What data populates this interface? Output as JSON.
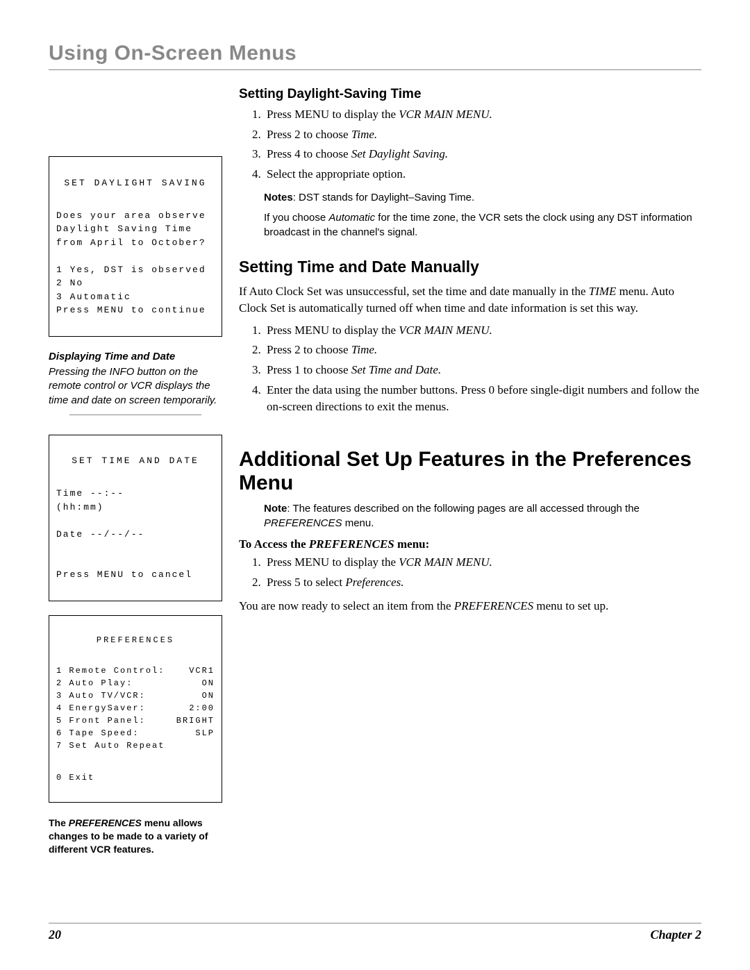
{
  "chapterTitle": "Using On-Screen Menus",
  "sidebar": {
    "osd_dst": {
      "title": "SET DAYLIGHT SAVING",
      "body": "Does your area observe\nDaylight Saving Time\nfrom April to October?\n\n1 Yes, DST is observed\n2 No\n3 Automatic\nPress MENU to continue"
    },
    "displayHeading": "Displaying Time and Date",
    "displayText": "Pressing the INFO button on the remote control or VCR displays the time and date on screen temporarily.",
    "osd_time": {
      "title": "SET TIME AND DATE",
      "body": "Time --:--\n    (hh:mm)\n\nDate --/--/--\n\n\nPress MENU to cancel"
    },
    "osd_pref": {
      "title": "PREFERENCES",
      "rows": [
        {
          "n": "1",
          "label": "Remote Control:",
          "val": "VCR1"
        },
        {
          "n": "2",
          "label": "Auto Play:",
          "val": "ON"
        },
        {
          "n": "3",
          "label": "Auto TV/VCR:",
          "val": "ON"
        },
        {
          "n": "4",
          "label": "EnergySaver:",
          "val": "2:00"
        },
        {
          "n": "5",
          "label": "Front Panel:",
          "val": "BRIGHT"
        },
        {
          "n": "6",
          "label": "Tape Speed:",
          "val": "SLP"
        },
        {
          "n": "7",
          "label": "Set Auto Repeat",
          "val": ""
        }
      ],
      "exit": "0 Exit"
    },
    "prefCaption": "The PREFERENCES menu allows changes to be made to a variety of different VCR features."
  },
  "main": {
    "dst": {
      "heading": "Setting Daylight-Saving Time",
      "steps": [
        {
          "pre": "Press MENU to display the ",
          "ital": "VCR MAIN MENU.",
          "post": ""
        },
        {
          "pre": "Press 2 to choose ",
          "ital": "Time.",
          "post": ""
        },
        {
          "pre": "Press 4 to choose ",
          "ital": "Set Daylight Saving.",
          "post": ""
        },
        {
          "pre": "Select the appropriate option.",
          "ital": "",
          "post": ""
        }
      ],
      "noteLabel": "Notes",
      "note1": ": DST stands for Daylight–Saving Time.",
      "note2a": "If you choose ",
      "note2ital": "Automatic",
      "note2b": " for the time zone, the VCR sets the clock using any DST information broadcast in the channel's signal."
    },
    "timedate": {
      "heading": "Setting Time and Date Manually",
      "intro_a": "If Auto Clock Set was unsuccessful, set the time and date manually in the ",
      "intro_ital": "TIME",
      "intro_b": " menu. Auto Clock Set is automatically turned off when time and date information is set this way.",
      "steps": [
        {
          "pre": "Press MENU to display the ",
          "ital": "VCR MAIN MENU.",
          "post": ""
        },
        {
          "pre": "Press 2 to choose ",
          "ital": "Time.",
          "post": ""
        },
        {
          "pre": "Press 1 to choose ",
          "ital": "Set Time and Date.",
          "post": ""
        },
        {
          "pre": "Enter the data using the number buttons. Press 0 before single-digit numbers and follow the on-screen directions to exit the menus.",
          "ital": "",
          "post": ""
        }
      ]
    },
    "prefSection": {
      "heading": "Additional Set Up Features in the Preferences Menu",
      "noteLabel": "Note",
      "note_a": ": The features described on the following pages are all accessed through the ",
      "note_ital": "PREFERENCES",
      "note_b": " menu.",
      "accessLabel_a": "To Access the ",
      "accessLabel_ital": "PREFERENCES",
      "accessLabel_b": " menu:",
      "steps": [
        {
          "pre": "Press MENU to display the ",
          "ital": "VCR MAIN MENU.",
          "post": ""
        },
        {
          "pre": "Press 5 to select ",
          "ital": "Preferences.",
          "post": ""
        }
      ],
      "outro_a": "You are now ready to select an item from the ",
      "outro_ital": "PREFERENCES",
      "outro_b": " menu to set up."
    }
  },
  "footer": {
    "pageNum": "20",
    "chapter": "Chapter 2"
  }
}
